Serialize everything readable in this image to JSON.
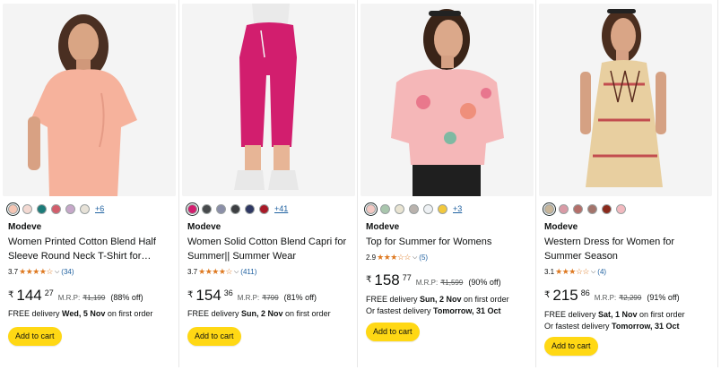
{
  "colors": {
    "accent_button": "#ffd814",
    "star": "#de7921",
    "link": "#2162a1"
  },
  "products": [
    {
      "swatches": [
        "#f6c6b4",
        "#f3d9d2",
        "#1c7b79",
        "#d25e6c",
        "#c6a7c9",
        "#e7e2d8"
      ],
      "more_colors": "+6",
      "brand": "Modeve",
      "title": "Women Printed Cotton Blend Half Sleeve Round Neck T-Shirt for…",
      "rating": "3.7",
      "stars": "★★★★☆",
      "reviews": "(34)",
      "currency": "₹",
      "price_whole": "144",
      "price_fraction": "27",
      "mrp_label": "M.R.P:",
      "mrp": "₹1,199",
      "discount": "(88% off)",
      "delivery_prefix": "FREE delivery ",
      "delivery_date": "Wed, 5 Nov",
      "delivery_suffix": " on first order",
      "fastest_prefix": "",
      "fastest_date": "",
      "cart_label": "Add to cart"
    },
    {
      "swatches": [
        "#d21e6e",
        "#474a4c",
        "#8b8fa8",
        "#3d3f42",
        "#2f3863",
        "#a81a28"
      ],
      "more_colors": "+41",
      "brand": "Modeve",
      "title": "Women Solid Cotton Blend Capri for Summer|| Summer Wear",
      "rating": "3.7",
      "stars": "★★★★☆",
      "reviews": "(411)",
      "currency": "₹",
      "price_whole": "154",
      "price_fraction": "36",
      "mrp_label": "M.R.P:",
      "mrp": "₹799",
      "discount": "(81% off)",
      "delivery_prefix": "FREE delivery ",
      "delivery_date": "Sun, 2 Nov",
      "delivery_suffix": " on first order",
      "fastest_prefix": "",
      "fastest_date": "",
      "cart_label": "Add to cart"
    },
    {
      "swatches": [
        "#f3c9c4",
        "#a9c6ad",
        "#e9e4d2",
        "#b9b2ad",
        "#eef1f4",
        "#f2c83d"
      ],
      "more_colors": "+3",
      "brand": "Modeve",
      "title": "Top for Summer for Womens",
      "rating": "2.9",
      "stars": "★★★☆☆",
      "reviews": "(5)",
      "currency": "₹",
      "price_whole": "158",
      "price_fraction": "77",
      "mrp_label": "M.R.P:",
      "mrp": "₹1,599",
      "discount": "(90% off)",
      "delivery_prefix": "FREE delivery ",
      "delivery_date": "Sun, 2 Nov",
      "delivery_suffix": " on first order",
      "fastest_prefix": "Or fastest delivery ",
      "fastest_date": "Tomorrow, 31 Oct",
      "cart_label": "Add to cart"
    },
    {
      "swatches": [
        "#c8b69a",
        "#d99ba6",
        "#b46f6a",
        "#a3746b",
        "#8a2a1c",
        "#f2b9bf"
      ],
      "more_colors": "",
      "brand": "Modeve",
      "title": "Western Dress for Women for Summer Season",
      "rating": "3.1",
      "stars": "★★★☆☆",
      "reviews": "(4)",
      "currency": "₹",
      "price_whole": "215",
      "price_fraction": "86",
      "mrp_label": "M.R.P:",
      "mrp": "₹2,299",
      "discount": "(91% off)",
      "delivery_prefix": "FREE delivery ",
      "delivery_date": "Sat, 1 Nov",
      "delivery_suffix": " on first order",
      "fastest_prefix": "Or fastest delivery ",
      "fastest_date": "Tomorrow, 31 Oct",
      "cart_label": "Add to cart"
    }
  ]
}
